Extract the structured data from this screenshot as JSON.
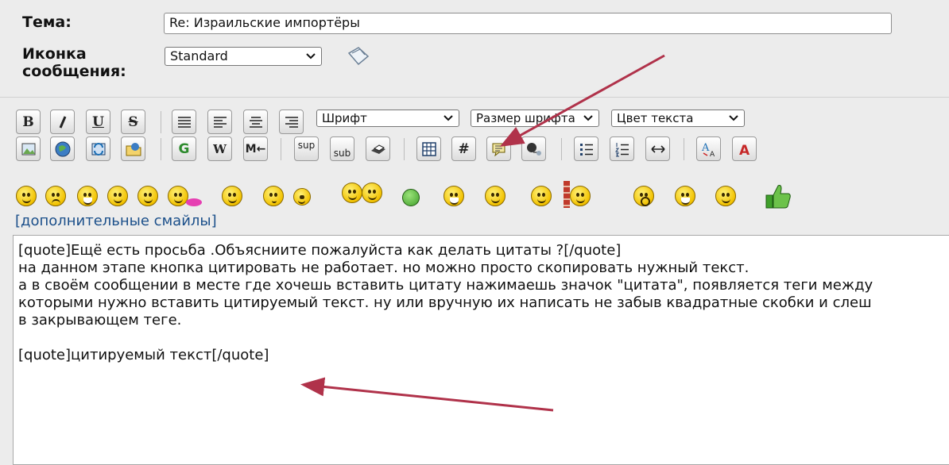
{
  "form": {
    "subject_label": "Тема:",
    "subject_value": "Re: Израильские импортёры",
    "icon_label": "Иконка\nсообщения:",
    "icon_select": "Standard"
  },
  "toolbar": {
    "bold": "B",
    "italic": "I",
    "underline": "U",
    "strike": "S",
    "font_select": "Шрифт",
    "size_select": "Размер шрифта",
    "color_select": "Цвет текста",
    "google": "G",
    "wiki": "W",
    "more": "M←",
    "sup": "sup",
    "sub": "sub",
    "code": "#"
  },
  "smilies": {
    "more_link": "[дополнительные смайлы]"
  },
  "editor": {
    "text": "[quote]Ещё есть просьба .Объясниите пожалуйста как делать цитаты ?[/quote]\nна данном этапе кнопка цитировать не работает. но можно просто скопировать нужный текст.\nа в своём сообщении в месте где хочешь вставить цитату нажимаешь значок \"цитата\", появляется теги между\nкоторыми нужно вставить цитируемый текст. ну или вручную их написать не забыв квадратные скобки и слеш\nв закрывающем теге.\n\n[quote]цитируемый текст[/quote]"
  },
  "colors": {
    "annotation_arrow": "#b0324a",
    "link": "#1b4f8a"
  }
}
